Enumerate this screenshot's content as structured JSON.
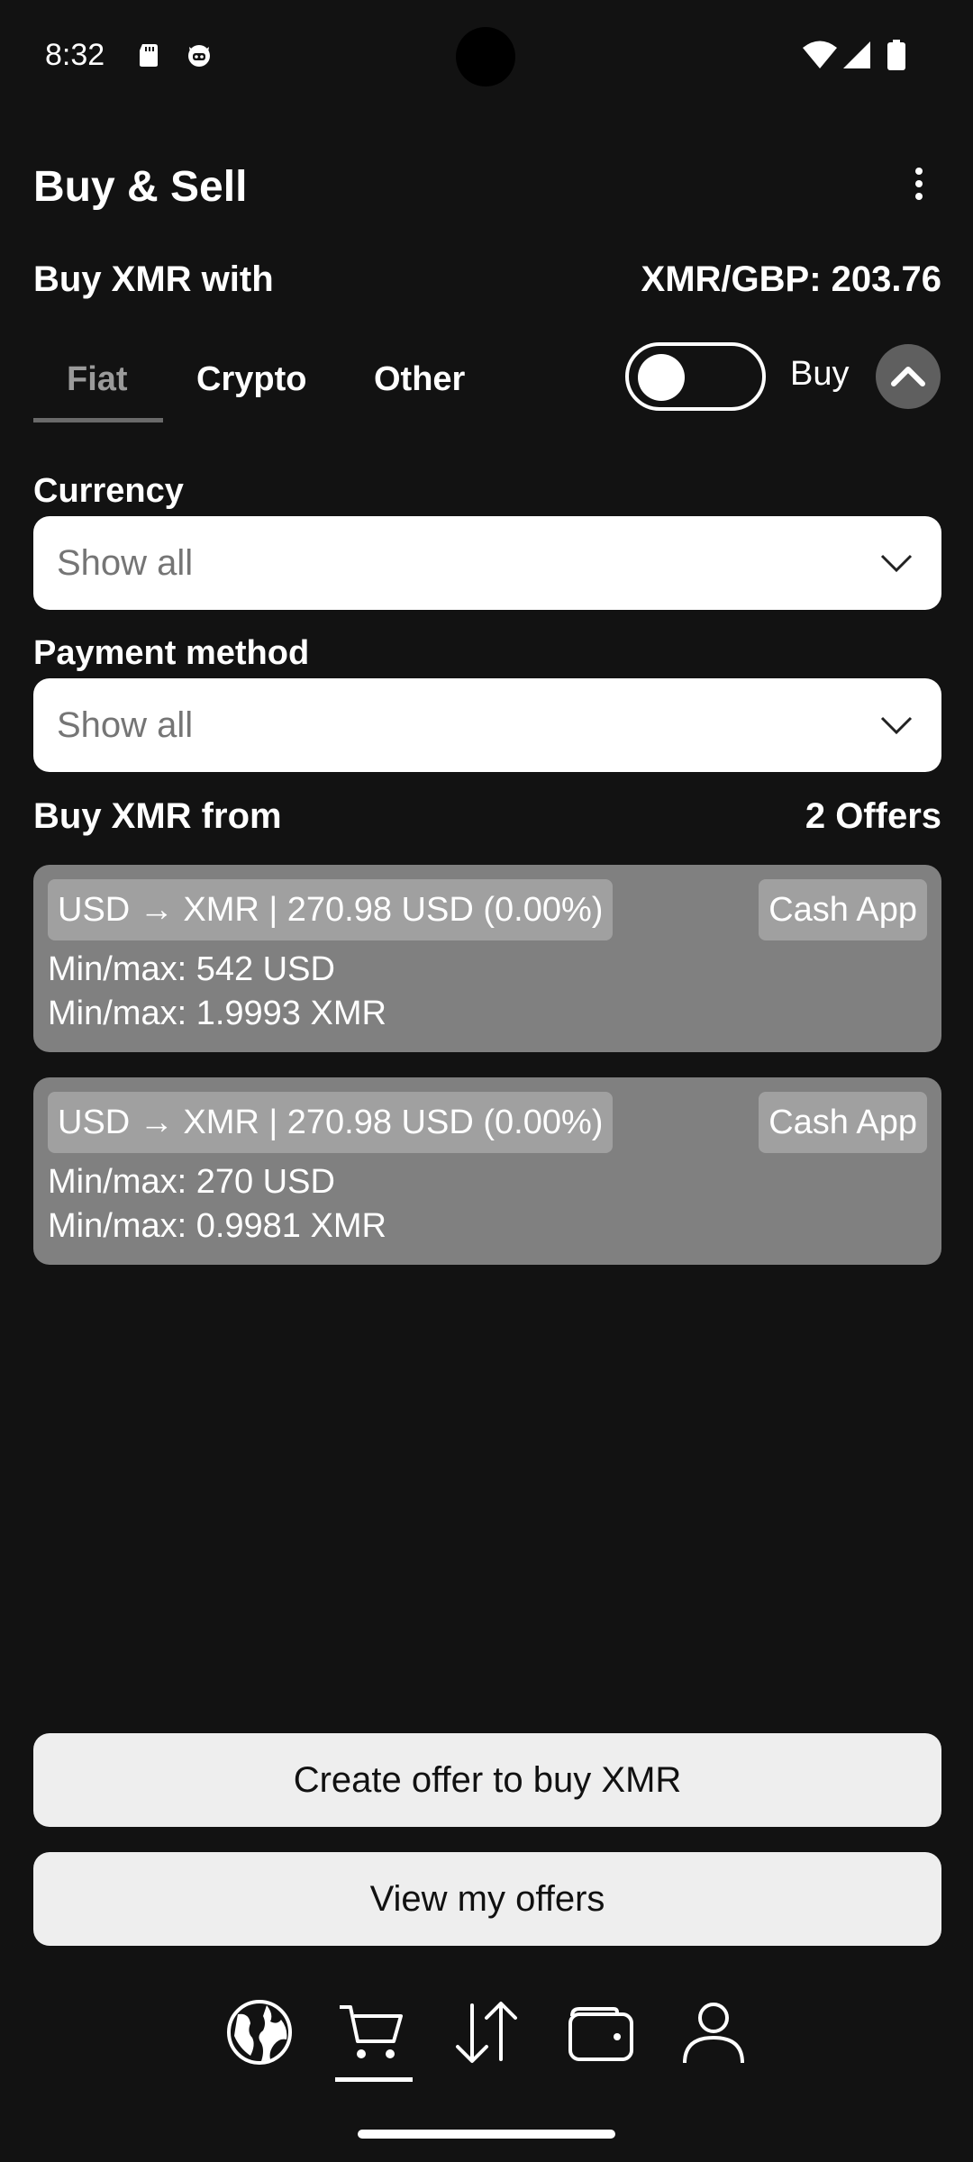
{
  "status_bar": {
    "time": "8:32",
    "left_icons": [
      "sd-card-icon",
      "cat-face-icon"
    ],
    "right_icons": [
      "wifi-icon",
      "signal-icon",
      "battery-icon"
    ]
  },
  "header": {
    "title": "Buy & Sell",
    "menu_icon": "more-vert-icon"
  },
  "trade": {
    "buy_with_label": "Buy XMR with",
    "rate_label": "XMR/GBP: 203.76",
    "tabs": [
      {
        "label": "Fiat",
        "active": true
      },
      {
        "label": "Crypto",
        "active": false
      },
      {
        "label": "Other",
        "active": false
      }
    ],
    "toggle_label": "Buy",
    "toggle_on": false
  },
  "filters": {
    "currency_label": "Currency",
    "currency_value": "Show all",
    "payment_label": "Payment method",
    "payment_value": "Show all"
  },
  "offers": {
    "section_title": "Buy XMR from",
    "count_label": "2 Offers",
    "items": [
      {
        "pair": "USD → XMR | 270.98 USD (0.00%)",
        "method": "Cash App",
        "min_max_fiat": "Min/max: 542 USD",
        "min_max_xmr": "Min/max: 1.9993 XMR"
      },
      {
        "pair": "USD → XMR | 270.98 USD (0.00%)",
        "method": "Cash App",
        "min_max_fiat": "Min/max: 270 USD",
        "min_max_xmr": "Min/max: 0.9981 XMR"
      }
    ]
  },
  "actions": {
    "create_offer": "Create offer to buy XMR",
    "view_offers": "View my offers"
  },
  "nav": {
    "items": [
      "globe-icon",
      "cart-icon",
      "swap-icon",
      "wallet-icon",
      "profile-icon"
    ],
    "active": "cart-icon"
  },
  "colors": {
    "background": "#121212",
    "card": "#808080",
    "chip": "#a0a0a0",
    "button": "#eeeeee"
  }
}
